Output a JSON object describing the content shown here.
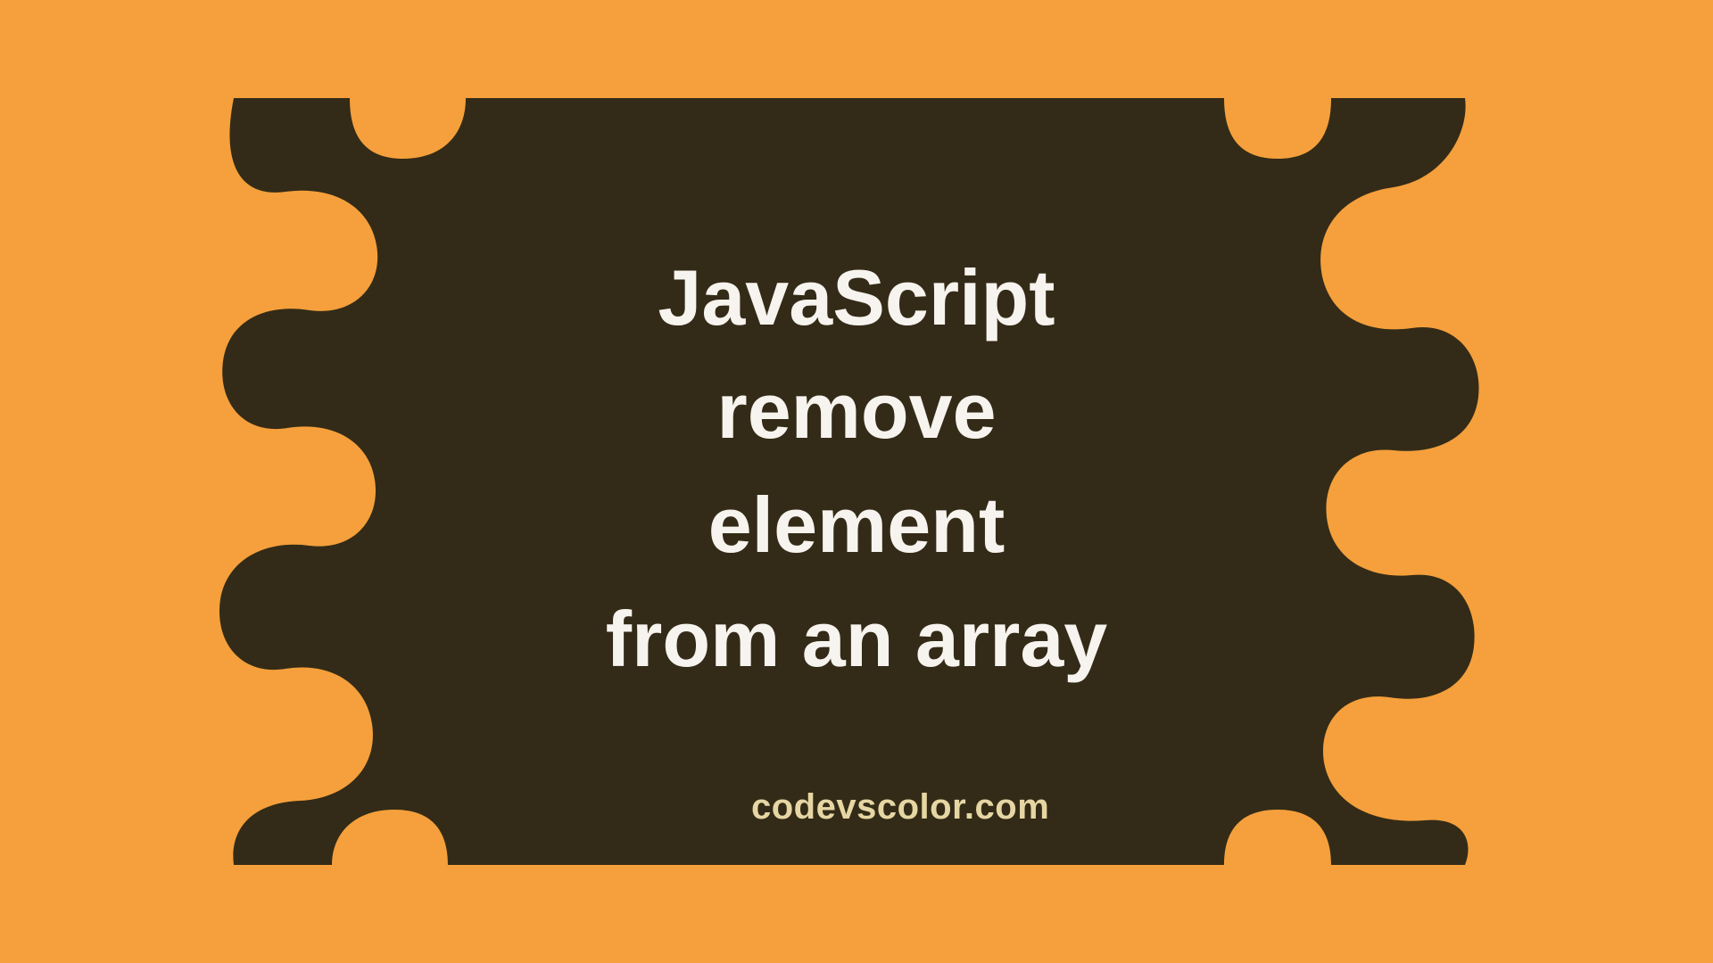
{
  "title": {
    "line1": "JavaScript",
    "line2": "remove",
    "line3": "element",
    "line4": "from an array"
  },
  "footer": "codevscolor.com",
  "colors": {
    "background": "#f5a03c",
    "blob": "#332b17",
    "text_primary": "#f7f3ee",
    "text_secondary": "#e6d6a3"
  }
}
